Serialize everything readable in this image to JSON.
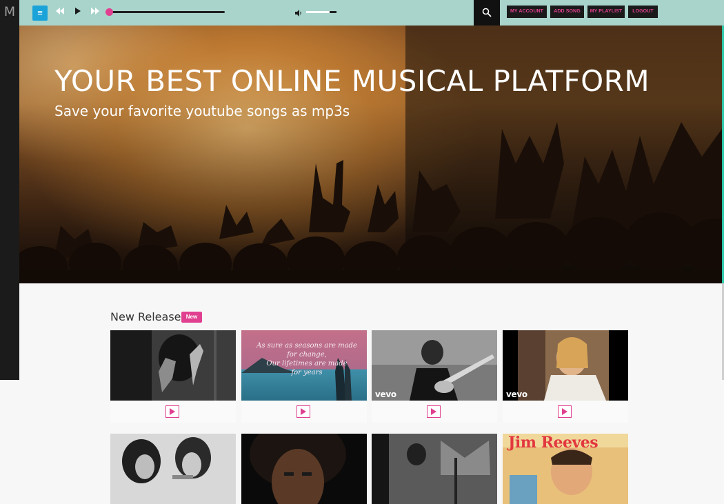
{
  "app": {
    "logo": "M"
  },
  "player": {
    "progress": 0.0,
    "volume": 0.75
  },
  "nav": {
    "my_account": "MY ACCOUNT",
    "add_song": "ADD SONG",
    "my_playlist": "MY PLAYLIST",
    "logout": "LOGOUT"
  },
  "hero": {
    "title": "YOUR BEST ONLINE MUSICAL PLATFORM",
    "subtitle": "Save your favorite youtube songs as mp3s"
  },
  "releases": {
    "title": "New Releases",
    "badge": "New",
    "row1": [
      {
        "label": ""
      },
      {
        "overlay": "As sure as seasons are made\nfor change,\nOur lifetimes are made\nfor years"
      },
      {
        "watermark": "vevo"
      },
      {
        "watermark": "vevo"
      }
    ],
    "row2": [
      {
        "label": ""
      },
      {
        "label": ""
      },
      {
        "label": ""
      },
      {
        "cover_text": "Jim Reeves"
      }
    ]
  },
  "colors": {
    "accent": "#e0408f",
    "topbar": "#a9d4cb",
    "menu_button": "#1aa3d9"
  }
}
